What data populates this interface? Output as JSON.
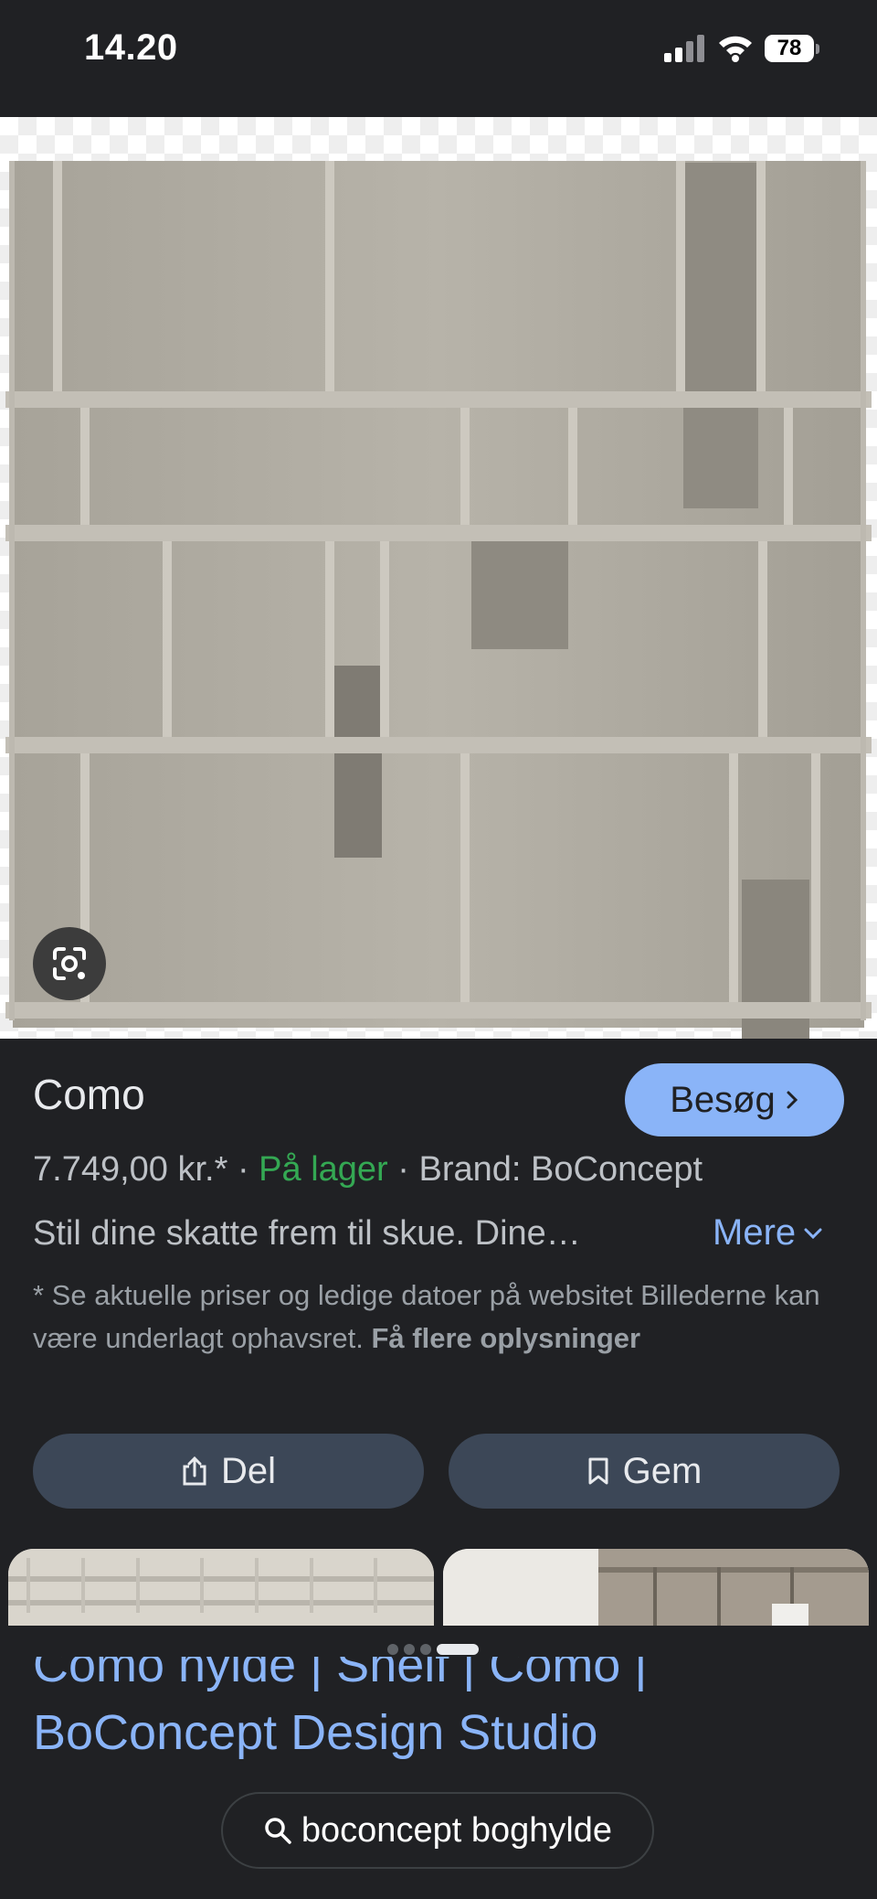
{
  "status": {
    "time": "14.20",
    "battery": "78"
  },
  "product": {
    "title": "Como",
    "visit_label": "Besøg",
    "price": "7.749,00 kr.*",
    "separator": "·",
    "stock": "På lager",
    "brand": "Brand: BoConcept",
    "description": "Stil dine skatte frem til skue. Dine…",
    "more_label": "Mere",
    "disclaimer_text": "* Se aktuelle priser og ledige datoer på websitet Billederne kan være underlagt ophavsret.",
    "disclaimer_link": "Få flere oplysninger"
  },
  "actions": {
    "share_label": "Del",
    "save_label": "Gem"
  },
  "result": {
    "title": "Como hylde | Shelf | Como | BoConcept Design Studio"
  },
  "search": {
    "query": "boconcept boghylde"
  },
  "colors": {
    "accent": "#8ab4f8",
    "stock_green": "#34a853",
    "background": "#202124",
    "button_bg": "#3c4757"
  },
  "icons": [
    "signal-icon",
    "wifi-icon",
    "battery-icon",
    "lens-icon",
    "chevron-right-icon",
    "chevron-down-icon",
    "share-icon",
    "bookmark-icon",
    "search-icon"
  ]
}
